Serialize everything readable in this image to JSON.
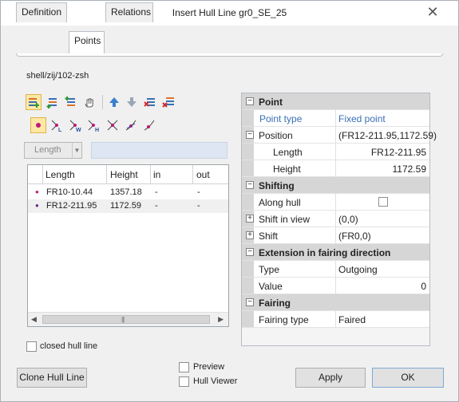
{
  "window": {
    "title": "Insert Hull Line gr0_SE_25",
    "close_glyph": "✕"
  },
  "tabs": [
    {
      "label": "Definition",
      "active": false
    },
    {
      "label": "Points",
      "active": true
    },
    {
      "label": "Relations",
      "active": false
    }
  ],
  "path_label": "shell/zij/102-zsh",
  "toolbar_row1_icons": [
    "insert-point-icon",
    "insert-point-after-icon",
    "insert-point-before-icon",
    "pick-point-icon",
    "move-up-icon",
    "move-down-icon",
    "delete-point-icon",
    "delete-all-points-icon"
  ],
  "toolbar_row2_icons": [
    "point-type-dot-icon",
    "knuckle-l-icon",
    "knuckle-w-icon",
    "knuckle-h-icon",
    "break-icon",
    "tangent-icon",
    "tangent-end-icon"
  ],
  "selector": {
    "value": "Length",
    "input_value": ""
  },
  "point_list": {
    "columns": [
      "Length",
      "Height",
      "in",
      "out"
    ],
    "rows": [
      {
        "length": "FR10-10.44",
        "height": "1357.18",
        "in": "-",
        "out": "-"
      },
      {
        "length": "FR12-211.95",
        "height": "1172.59",
        "in": "-",
        "out": "-"
      }
    ]
  },
  "closed_hull_line": {
    "label": "closed hull line",
    "checked": false
  },
  "properties": {
    "point": {
      "title": "Point",
      "point_type_label": "Point type",
      "point_type_value": "Fixed point",
      "position_label": "Position",
      "position_value": "(FR12-211.95,1172.59)",
      "length_label": "Length",
      "length_value": "FR12-211.95",
      "height_label": "Height",
      "height_value": "1172.59"
    },
    "shifting": {
      "title": "Shifting",
      "along_hull_label": "Along hull",
      "along_hull_checked": false,
      "shift_in_view_label": "Shift in view",
      "shift_in_view_value": "(0,0)",
      "shift_label": "Shift",
      "shift_value": "(FR0,0)"
    },
    "extension": {
      "title": "Extension in fairing direction",
      "type_label": "Type",
      "type_value": "Outgoing",
      "value_label": "Value",
      "value_value": "0"
    },
    "fairing": {
      "title": "Fairing",
      "fairing_type_label": "Fairing type",
      "fairing_type_value": "Faired"
    },
    "collapse_glyph": "⊟",
    "expand_glyph": "⊞"
  },
  "buttons": {
    "clone": "Clone Hull Line",
    "apply": "Apply",
    "ok": "OK"
  },
  "preview": {
    "label": "Preview",
    "checked": false
  },
  "hull_viewer": {
    "label": "Hull Viewer",
    "checked": false
  },
  "colors": {
    "accent_blue": "#3a6fb5",
    "selected_tool": "#fde8a5"
  }
}
